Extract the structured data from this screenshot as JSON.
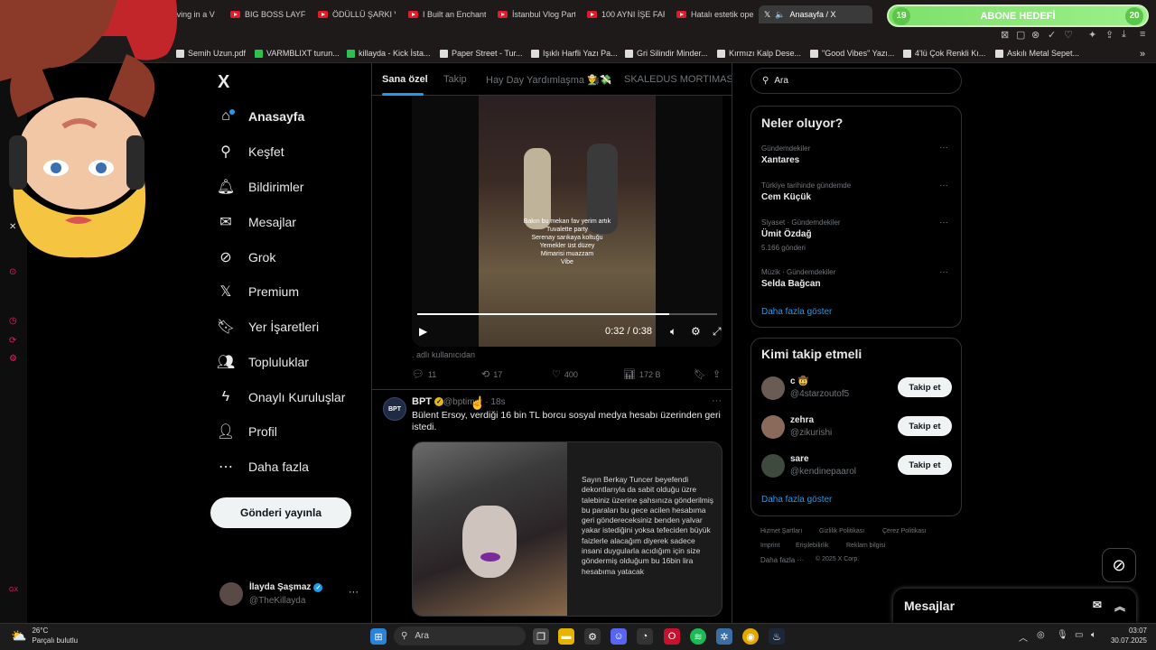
{
  "browser": {
    "tabs": [
      {
        "label": "V: Living in a V"
      },
      {
        "label": "BIG BOSS LAYF -"
      },
      {
        "label": "ÖDÜLLÜ ŞARKI V"
      },
      {
        "label": "I Built an Enchant"
      },
      {
        "label": "İstanbul Vlog Part"
      },
      {
        "label": "100 AYNI İŞE FAR"
      },
      {
        "label": "Hatalı estetik ope"
      },
      {
        "label": "Anasayfa / X"
      }
    ],
    "subscriber_goal": {
      "current": "19",
      "label": "ABONE HEDEFİ",
      "target": "20"
    },
    "bookmarks": [
      {
        "label": "Semih Uzun.pdf"
      },
      {
        "label": "VARMBLIXT turun..."
      },
      {
        "label": "killayda - Kick İsta..."
      },
      {
        "label": "Paper Street - Tur..."
      },
      {
        "label": "Işıklı Harfli Yazı Pa..."
      },
      {
        "label": "Gri Silindir Minder..."
      },
      {
        "label": "Kırmızı Kalp Dese..."
      },
      {
        "label": "\"Good Vibes\" Yazı..."
      },
      {
        "label": "4'lü Çok Renkli Kı..."
      },
      {
        "label": "Askılı Metal Sepet..."
      }
    ]
  },
  "sidebar": {
    "logo": "X",
    "items": [
      {
        "label": "Anasayfa",
        "icon": "home-icon"
      },
      {
        "label": "Keşfet",
        "icon": "search-icon"
      },
      {
        "label": "Bildirimler",
        "icon": "bell-icon"
      },
      {
        "label": "Mesajlar",
        "icon": "mail-icon"
      },
      {
        "label": "Grok",
        "icon": "grok-icon"
      },
      {
        "label": "Premium",
        "icon": "x-icon"
      },
      {
        "label": "Yer İşaretleri",
        "icon": "bookmark-icon"
      },
      {
        "label": "Topluluklar",
        "icon": "communities-icon"
      },
      {
        "label": "Onaylı Kuruluşlar",
        "icon": "lightning-icon"
      },
      {
        "label": "Profil",
        "icon": "person-icon"
      },
      {
        "label": "Daha fazla",
        "icon": "more-circle-icon"
      }
    ],
    "post_button": "Gönderi yayınla",
    "account": {
      "name": "İlayda Şaşmaz",
      "handle": "@TheKillayda"
    }
  },
  "main": {
    "tabs": [
      {
        "label": "Sana özel"
      },
      {
        "label": "Takip"
      },
      {
        "label": "Hay Day Yardımlaşma 👨‍🌾💸"
      },
      {
        "label": "SKALEDUS MORTIMAS"
      }
    ],
    "video": {
      "overlay_lines": [
        "Bakın bu mekan fav yerim artık",
        "Tuvalette party",
        "Serenay sarıkaya koltuğu",
        "Yemekler üst düzey",
        "Mimarisi muazzam",
        "Vibe"
      ],
      "time": "0:32 / 0:38",
      "progress": 0.84
    },
    "caption": ". adlı kullanıcıdan",
    "actions": {
      "replies": "11",
      "reposts": "17",
      "likes": "400",
      "views": "172 B"
    },
    "post": {
      "avatar_text": "BPT",
      "name": "BPT",
      "handle": "@bptimer · 18s",
      "text": "Bülent Ersoy, verdiği 16 bin TL borcu sosyal medya hesabı üzerinden geri istedi.",
      "image_letter": "Sayın Berkay Tuncer beyefendi dekontlarıyla da sabit olduğu üzre talebiniz üzerine şahsınıza gönderilmiş bu paraları bu gece acilen hesabıma geri göndereceksiniz benden yalvar yakar istediğini yoksa tefeciden büyük faizlerle alacağım diyerek sadece insani duygularla acıdığım için size göndermiş olduğum bu 16bin lira hesabıma yatacak"
    }
  },
  "right": {
    "search_placeholder": "Ara",
    "trends_title": "Neler oluyor?",
    "trends": [
      {
        "category": "Gündemdekiler",
        "name": "Xantares",
        "count": ""
      },
      {
        "category": "Türkiye tarihinde gündemde",
        "name": "Cem Küçük",
        "count": ""
      },
      {
        "category": "Siyaset · Gündemdekiler",
        "name": "Ümit Özdağ",
        "count": "5.166 gönderi"
      },
      {
        "category": "Müzik · Gündemdekiler",
        "name": "Selda Bağcan",
        "count": ""
      }
    ],
    "show_more": "Daha fazla göster",
    "who_title": "Kimi takip etmeli",
    "who": [
      {
        "name": "c 🤠",
        "handle": "@4starzoutof5"
      },
      {
        "name": "zehra",
        "handle": "@zikurishi"
      },
      {
        "name": "sare",
        "handle": "@kendinepaarol"
      }
    ],
    "follow_label": "Takip et",
    "footer": [
      "Hizmet Şartları",
      "Gizlilik Politikası",
      "Çerez Politikası",
      "Imprint",
      "Erişilebilirlik",
      "Reklam bilgisi",
      "Daha fazla ···",
      "© 2025 X Corp."
    ],
    "messages_dock": "Mesajlar"
  },
  "taskbar": {
    "weather_temp": "26°C",
    "weather_desc": "Parçalı bulutlu",
    "search": "Ara",
    "time": "03:07",
    "date": "30.07.2025"
  }
}
